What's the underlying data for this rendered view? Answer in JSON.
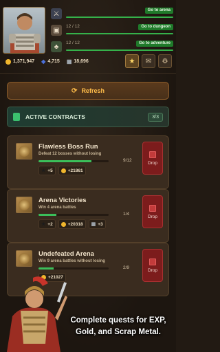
{
  "header": {
    "bars": [
      {
        "icon": "arena-icon",
        "count": "",
        "button": "Go to arena"
      },
      {
        "icon": "dungeon-icon",
        "count": "12 / 12",
        "button": "Go to dungeon"
      },
      {
        "icon": "adventure-icon",
        "count": "12 / 12",
        "button": "Go to adventure"
      }
    ],
    "resources": {
      "gold": "1,371,947",
      "gems": "4,715",
      "scrap": "18,696"
    }
  },
  "refresh_label": "Refresh",
  "contracts": {
    "title": "ACTIVE CONTRACTS",
    "count": "3/3"
  },
  "cards": [
    {
      "title": "Flawless Boss Run",
      "desc": "Defeat 12 bosses without losing",
      "progress": "9/12",
      "progress_frac": 0.75,
      "rewards": [
        {
          "type": "exp",
          "value": "+5"
        },
        {
          "type": "gold",
          "value": "+21861"
        }
      ],
      "drop": "Drop"
    },
    {
      "title": "Arena Victories",
      "desc": "Win 4 arena battles",
      "progress": "1/4",
      "progress_frac": 0.25,
      "rewards": [
        {
          "type": "exp",
          "value": "+2"
        },
        {
          "type": "gold",
          "value": "+20318"
        },
        {
          "type": "scrap",
          "value": "+3"
        }
      ],
      "drop": "Drop"
    },
    {
      "title": "Undefeated Arena",
      "desc": "Win 9 arena battles without losing",
      "progress": "2/9",
      "progress_frac": 0.22,
      "rewards": [
        {
          "type": "gold",
          "value": "+21027"
        }
      ],
      "drop": "Drop"
    }
  ],
  "promo": "Complete quests for EXP, Gold, and Scrap Metal.",
  "colors": {
    "go": "#1f7a2a",
    "bar": "#35b14a",
    "gold": "#f0b62d",
    "gem": "#4b6fd8",
    "drop": "#7c1c1c",
    "accent": "#ffbd4a"
  }
}
